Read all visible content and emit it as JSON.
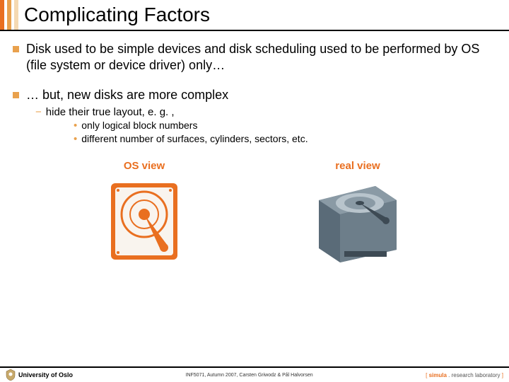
{
  "title": "Complicating Factors",
  "bullets": [
    {
      "text": "Disk used to be simple devices and disk scheduling used to be performed by OS (file system or device driver) only…"
    },
    {
      "text": "… but, new disks are more complex",
      "sub": [
        {
          "text": "hide their true layout, e. g. ,",
          "sub": [
            {
              "text": "only logical block numbers"
            },
            {
              "text": "different number of surfaces, cylinders, sectors, etc."
            }
          ]
        }
      ]
    }
  ],
  "views": {
    "left_label": "OS view",
    "right_label": "real view"
  },
  "footer": {
    "left": "University of Oslo",
    "center": "INF5071, Autumn 2007, Carsten Griwodz & Pål Halvorsen",
    "right_bracket_open": "[ ",
    "right_brand": "simula",
    "right_dot": " . ",
    "right_rest": "research laboratory",
    "right_bracket_close": " ]"
  }
}
